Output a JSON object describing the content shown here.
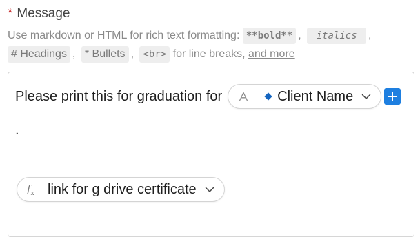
{
  "field": {
    "required_marker": "*",
    "label": "Message"
  },
  "help": {
    "intro": "Use markdown or HTML for rich text formatting:",
    "bold_code": "**bold**",
    "italics_code": "_italics_",
    "sep": ",",
    "headings_code": "# Headings",
    "bullets_code": "* Bullets",
    "br_code": "<br>",
    "line_breaks_text": "for line breaks,",
    "more_link": "and more"
  },
  "editor": {
    "line1_text": "Please print this for graduation for",
    "client_pill": {
      "type_icon": "A",
      "label": "Client Name",
      "icon_name": "text-type-icon",
      "accent_color": "#1565c0"
    },
    "add_button_color": "#1e7fe0",
    "line2_text": ".",
    "link_pill": {
      "fx_icon": "f",
      "fx_sub": "x",
      "label": "link for g drive certificate"
    }
  }
}
